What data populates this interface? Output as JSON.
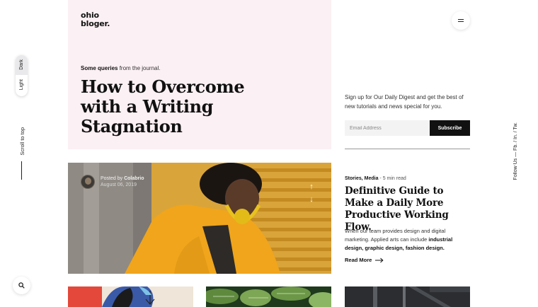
{
  "brand": {
    "logo_line1": "ohio",
    "logo_line2": "bloger."
  },
  "theme_toggle": {
    "dark_label": "Dark",
    "light_label": "Light"
  },
  "scroll": {
    "label": "Scroll to top"
  },
  "hero": {
    "kicker_bold": "Some queries",
    "kicker_rest": " from the journal.",
    "title": "How to Overcome with a Writing Stagnation"
  },
  "newsletter": {
    "text": "Sign up for Our Daily Digest and get the best of new tutorials and news special for you.",
    "email_placeholder": "Email Address",
    "button_label": "Subscribe"
  },
  "social": {
    "label": "Follow Us  —  Fb.  /  In.  /  Tw."
  },
  "featured_post": {
    "posted_prefix": "Posted by ",
    "author": "Colabrio",
    "date": "August 06, 2019"
  },
  "article": {
    "category": "Stories, Media",
    "read_time": " - 5 min read",
    "title": "Definitive Guide to Make a Daily More Productive Working Flow.",
    "excerpt_prefix": "When our team provides design and digital marketing. Applied arts can include ",
    "excerpt_bold": "industrial design, graphic design, fashion design.",
    "read_more": "Read More"
  },
  "icons": {
    "search": "search-icon",
    "menu": "menu-icon",
    "arrow_up": "arrow-up-icon",
    "arrow_down": "arrow-down-icon",
    "arrow_right": "arrow-right-icon"
  },
  "colors": {
    "hero_bg": "#fbf0f3",
    "accent_dark": "#111111",
    "input_bg": "#f3f3f4"
  }
}
